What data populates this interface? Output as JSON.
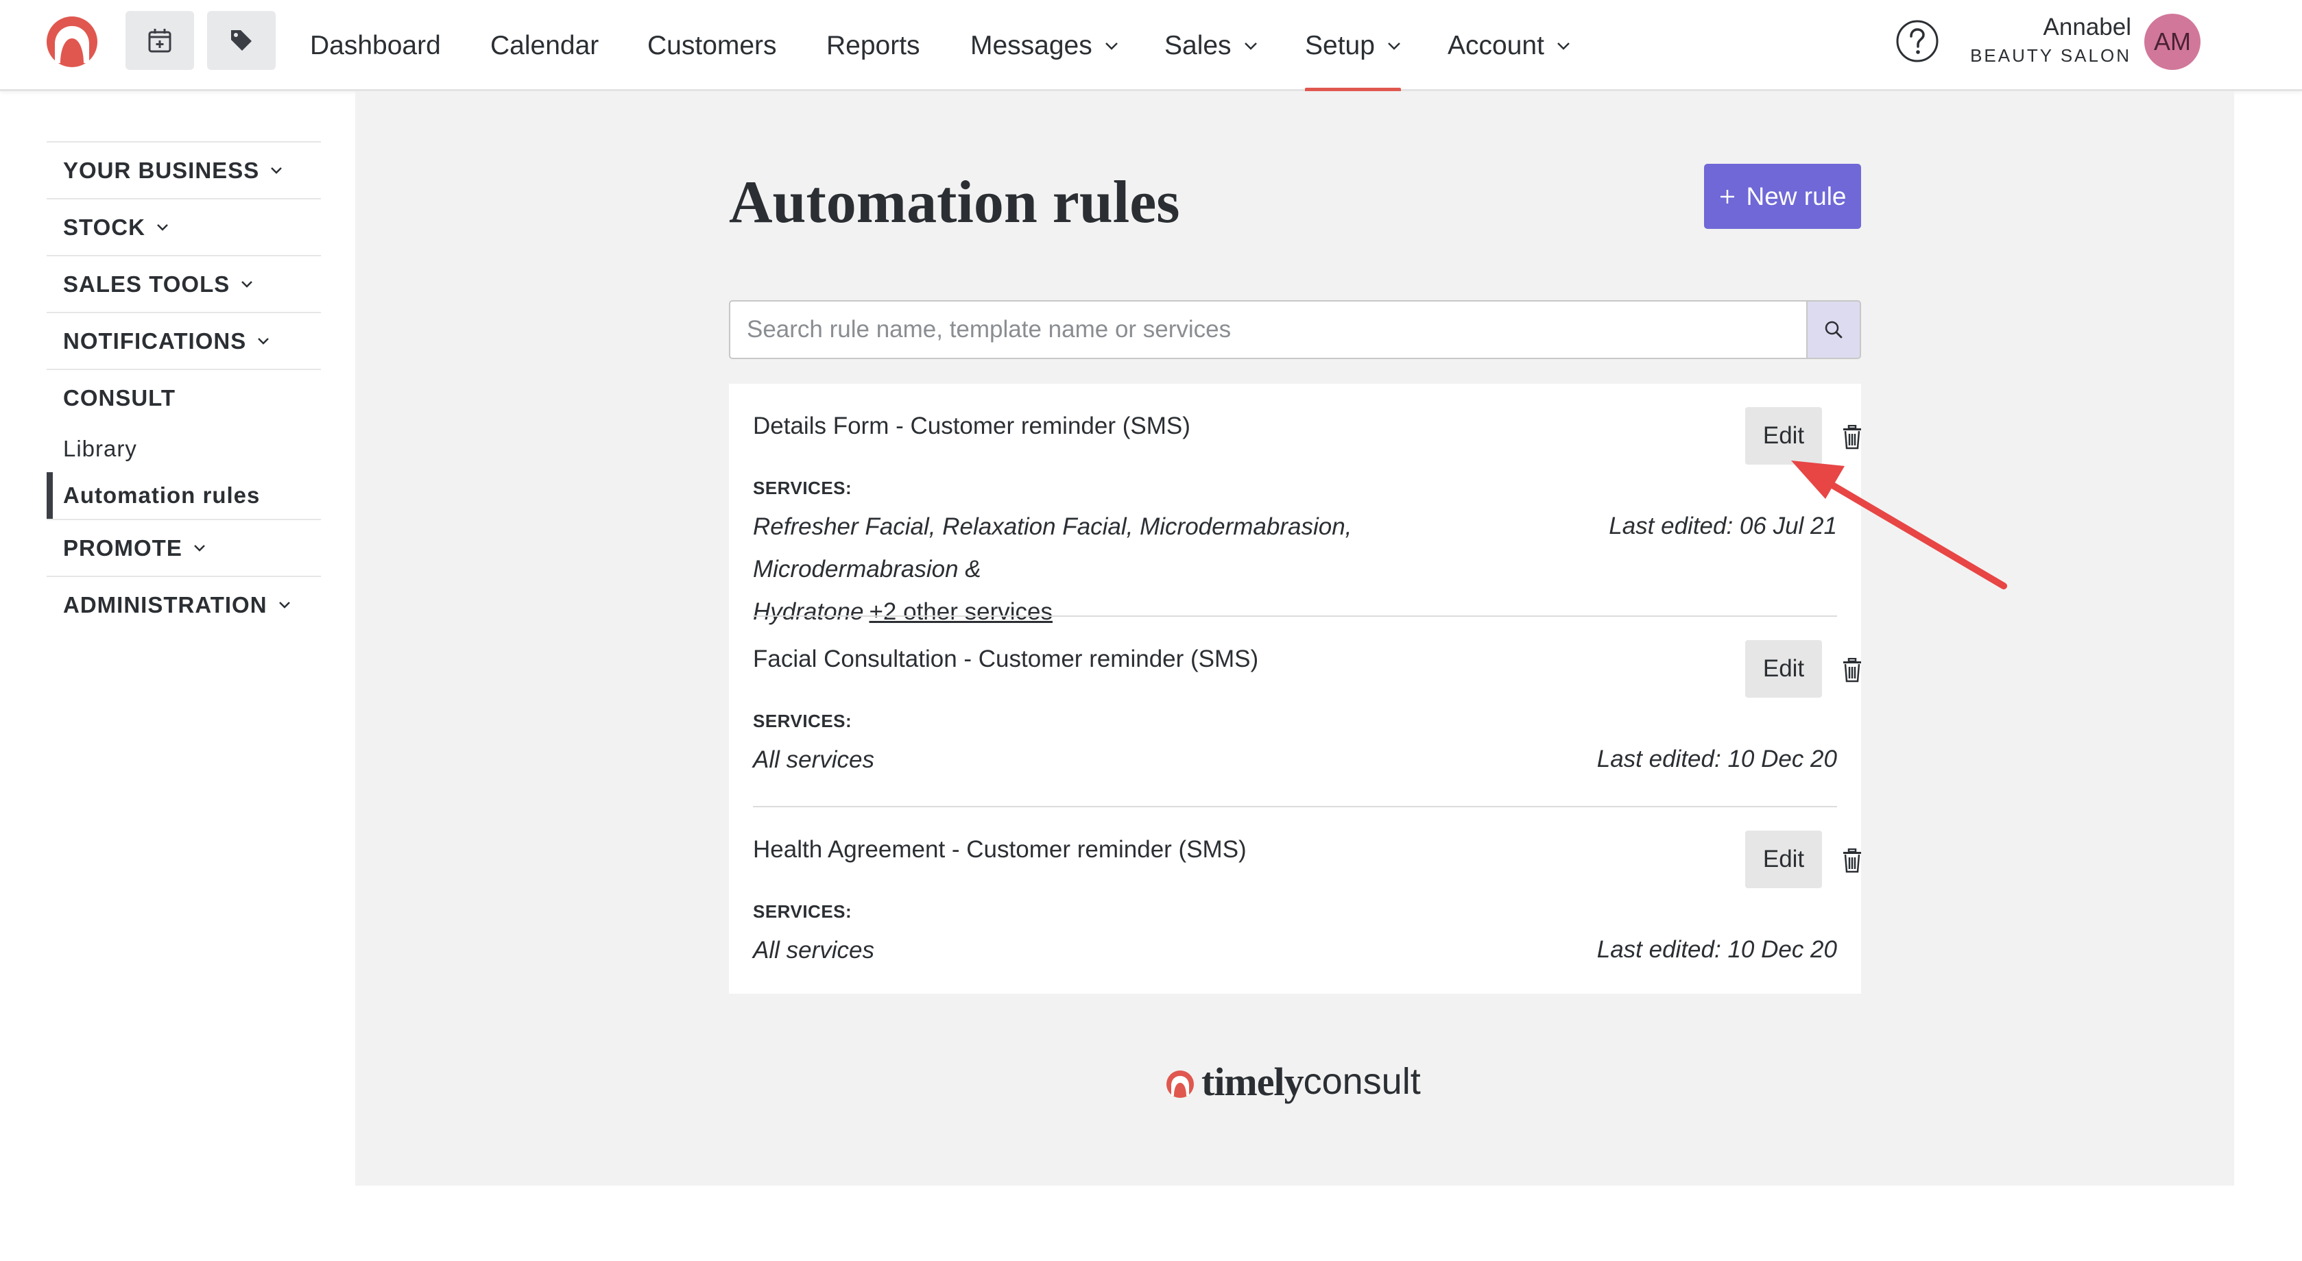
{
  "nav": {
    "items": [
      {
        "label": "Dashboard"
      },
      {
        "label": "Calendar"
      },
      {
        "label": "Customers"
      },
      {
        "label": "Reports"
      },
      {
        "label": "Messages"
      },
      {
        "label": "Sales"
      },
      {
        "label": "Setup"
      },
      {
        "label": "Account"
      }
    ],
    "active": "Setup",
    "icons": [
      "calendar-plus-icon",
      "tag-icon",
      "help-icon"
    ]
  },
  "user": {
    "name": "Annabel",
    "business": "BEAUTY SALON",
    "initials": "AM",
    "avatar_color": "#d1779a"
  },
  "sidebar": {
    "sections": [
      {
        "label": "YOUR BUSINESS"
      },
      {
        "label": "STOCK"
      },
      {
        "label": "SALES TOOLS"
      },
      {
        "label": "NOTIFICATIONS"
      },
      {
        "label": "CONSULT"
      },
      {
        "label": "PROMOTE"
      },
      {
        "label": "ADMINISTRATION"
      }
    ],
    "consult_items": [
      {
        "label": "Library"
      },
      {
        "label": "Automation rules"
      }
    ],
    "active_item": "Automation rules"
  },
  "page": {
    "title": "Automation rules",
    "new_rule_label": "New rule",
    "new_rule_icon": "plus-icon",
    "accent_color": "#6f68d6"
  },
  "search": {
    "placeholder": "Search rule name, template name or services",
    "value": ""
  },
  "rules": [
    {
      "title": "Details Form - Customer reminder (SMS)",
      "services_label": "SERVICES:",
      "services_line1": "Refresher Facial, Relaxation Facial, Microdermabrasion, Microdermabrasion &",
      "services_line2": "Hydratone",
      "more_link": "+2 other services",
      "last_edited": "Last edited: 06 Jul 21",
      "edit_label": "Edit"
    },
    {
      "title": "Facial Consultation - Customer reminder (SMS)",
      "services_label": "SERVICES:",
      "services": "All services",
      "last_edited": "Last edited: 10 Dec 20",
      "edit_label": "Edit"
    },
    {
      "title": "Health Agreement - Customer reminder (SMS)",
      "services_label": "SERVICES:",
      "services": "All services",
      "last_edited": "Last edited: 10 Dec 20",
      "edit_label": "Edit"
    }
  ],
  "footer": {
    "brand_bold": "timely",
    "brand_light": "consult"
  },
  "annotation": {
    "arrow_color": "#e84545"
  }
}
